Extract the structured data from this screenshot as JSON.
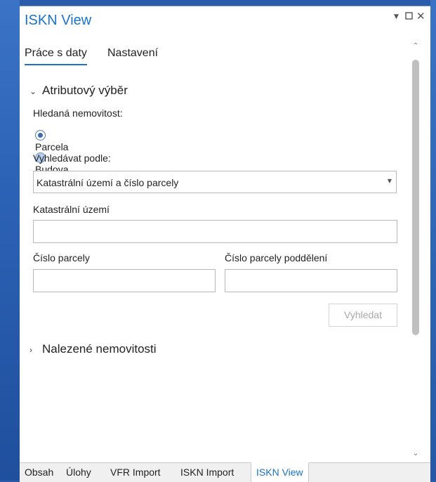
{
  "window": {
    "title": "ISKN View",
    "controls": {
      "menu_icon": "chevron-down-icon",
      "maximize_icon": "maximize-icon",
      "close_icon": "close-icon"
    }
  },
  "tabs": [
    {
      "label": "Práce s daty",
      "active": true
    },
    {
      "label": "Nastavení",
      "active": false
    }
  ],
  "attribute_section": {
    "title": "Atributový výběr",
    "expanded": true,
    "property_label": "Hledaná nemovitost:",
    "radios": [
      {
        "label": "Parcela",
        "checked": true
      },
      {
        "label": "Budova",
        "checked": false
      }
    ],
    "search_by_label": "Vyhledávat podle:",
    "search_by_value": "Katastrální území a číslo parcely",
    "cadastral_label": "Katastrální území",
    "cadastral_value": "",
    "parcel_number_label": "Číslo parcely",
    "parcel_number_value": "",
    "parcel_sub_label": "Číslo parcely poddělení",
    "parcel_sub_value": "",
    "search_button": "Vyhledat"
  },
  "found_section": {
    "title": "Nalezené nemovitosti",
    "expanded": false
  },
  "bottom_tabs": [
    {
      "label": "Obsah",
      "active": false
    },
    {
      "label": "Úlohy",
      "active": false
    },
    {
      "label": "VFR Import",
      "active": false
    },
    {
      "label": "ISKN Import",
      "active": false
    },
    {
      "label": "ISKN View",
      "active": true
    }
  ],
  "colors": {
    "accent": "#1a73c9",
    "desktop": "#2a5cab",
    "disabled_text": "#a8a8a8"
  }
}
